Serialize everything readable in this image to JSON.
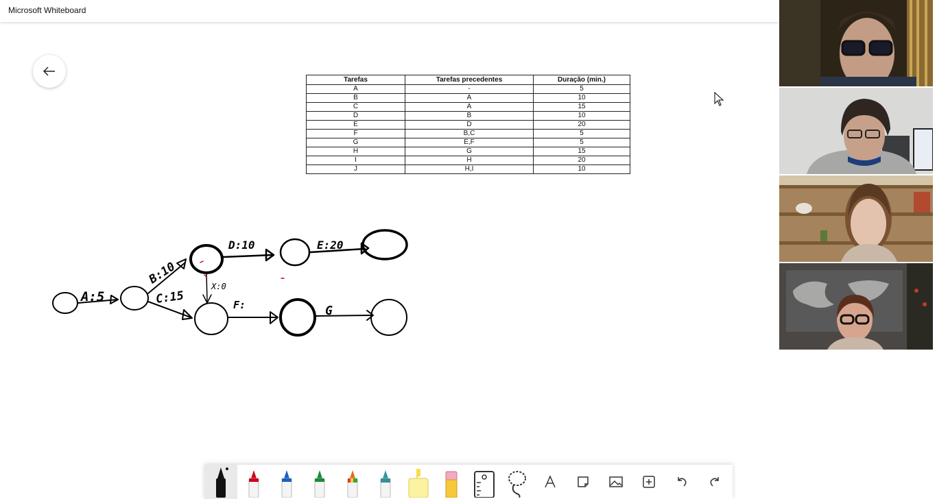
{
  "window": {
    "title": "Microsoft Whiteboard"
  },
  "table": {
    "headers": [
      "Tarefas",
      "Tarefas precedentes",
      "Duração (min.)"
    ],
    "rows": [
      [
        "A",
        "-",
        "5"
      ],
      [
        "B",
        "A",
        "10"
      ],
      [
        "C",
        "A",
        "15"
      ],
      [
        "D",
        "B",
        "10"
      ],
      [
        "E",
        "D",
        "20"
      ],
      [
        "F",
        "B,C",
        "5"
      ],
      [
        "G",
        "E,F",
        "5"
      ],
      [
        "H",
        "G",
        "15"
      ],
      [
        "I",
        "H",
        "20"
      ],
      [
        "J",
        "H,I",
        "10"
      ]
    ]
  },
  "diagram": {
    "labels": {
      "a": "A:5",
      "b": "B:10",
      "c": "C:15",
      "d": "D:10",
      "e": "E:20",
      "x": "X:0",
      "f": "F:",
      "g": "G"
    }
  },
  "toolbar": {
    "tools": [
      "pen-black",
      "pen-red",
      "pen-blue",
      "pen-green",
      "pen-rainbow",
      "pen-galaxy",
      "highlighter",
      "eraser",
      "ruler",
      "lasso",
      "text",
      "note",
      "image",
      "add",
      "undo",
      "redo"
    ]
  },
  "participants": [
    "participant-1",
    "participant-2",
    "participant-3",
    "participant-4"
  ],
  "colors": {
    "accent": "#d0021b",
    "ink": "#000000"
  }
}
